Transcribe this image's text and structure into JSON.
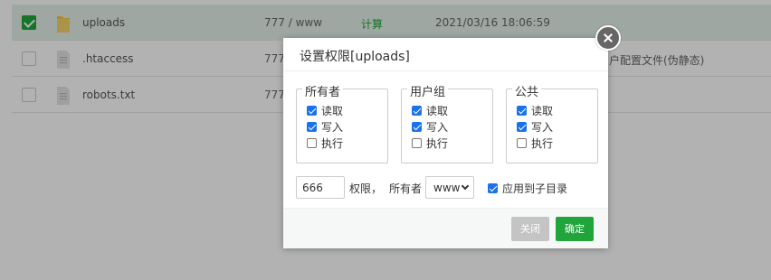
{
  "files": [
    {
      "name": "uploads",
      "type": "folder",
      "selected": true,
      "perm": "777 / www",
      "size": "计算",
      "mtime": "2021/03/16 18:06:59",
      "note": ""
    },
    {
      "name": ".htaccess",
      "type": "file",
      "selected": false,
      "perm": "777",
      "size": "",
      "mtime": "",
      "note": "用户配置文件(伪静态)"
    },
    {
      "name": "robots.txt",
      "type": "file",
      "selected": false,
      "perm": "777",
      "size": "",
      "mtime": "",
      "note": ""
    }
  ],
  "dialog": {
    "title": "设置权限[uploads]",
    "groups": [
      {
        "label": "所有者",
        "read": "读取",
        "write": "写入",
        "exec": "执行",
        "read_on": true,
        "write_on": true,
        "exec_on": false
      },
      {
        "label": "用户组",
        "read": "读取",
        "write": "写入",
        "exec": "执行",
        "read_on": true,
        "write_on": true,
        "exec_on": false
      },
      {
        "label": "公共",
        "read": "读取",
        "write": "写入",
        "exec": "执行",
        "read_on": true,
        "write_on": true,
        "exec_on": false
      }
    ],
    "perm_value": "666",
    "perm_unit": "权限，",
    "owner_label": "所有者",
    "owner_value": "www",
    "recursive_label": "应用到子目录",
    "recursive_on": true,
    "btn_close": "关闭",
    "btn_ok": "确定"
  },
  "colors": {
    "accent": "#20a53a",
    "checkbox": "#1a73e8"
  }
}
